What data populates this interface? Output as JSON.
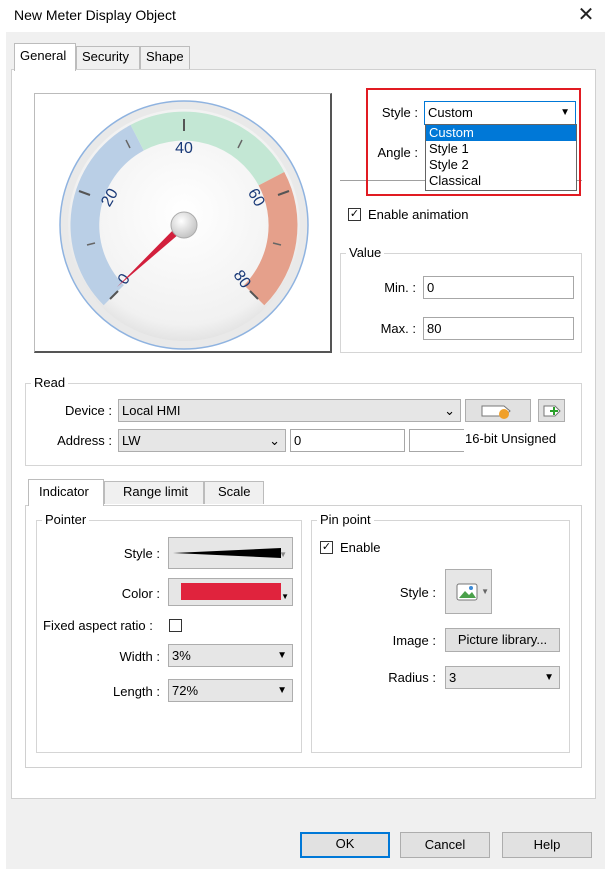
{
  "window": {
    "title": "New Meter Display Object",
    "close_icon": "close-icon"
  },
  "tabs": [
    "General",
    "Security",
    "Shape"
  ],
  "meter": {
    "ticks": [
      "0",
      "20",
      "40",
      "60",
      "80"
    ],
    "low_color": "#b9cde3",
    "mid_color": "#bfe5d2",
    "high_color": "#e49c88",
    "needle_color": "#d21f3c"
  },
  "style": {
    "label": "Style :",
    "selected": "Custom",
    "options": [
      "Custom",
      "Style 1",
      "Style 2",
      "Classical"
    ]
  },
  "angle": {
    "label": "Angle :"
  },
  "enable_animation": {
    "label": "Enable animation",
    "checked": true
  },
  "value_group": {
    "title": "Value",
    "min_label": "Min. :",
    "min_value": "0",
    "max_label": "Max. :",
    "max_value": "80"
  },
  "read_group": {
    "title": "Read",
    "device_label": "Device :",
    "device_value": "Local HMI",
    "address_label": "Address :",
    "address_type": "LW",
    "address_value": "0",
    "data_format": "16-bit Unsigned"
  },
  "sub_tabs": [
    "Indicator",
    "Range limit",
    "Scale"
  ],
  "pointer_group": {
    "title": "Pointer",
    "style_label": "Style :",
    "color_label": "Color :",
    "color_value": "#e0233d",
    "fixed_aspect_label": "Fixed aspect ratio :",
    "fixed_aspect_checked": false,
    "width_label": "Width :",
    "width_value": "3%",
    "length_label": "Length :",
    "length_value": "72%"
  },
  "pin_point_group": {
    "title": "Pin point",
    "enable_label": "Enable",
    "enable_checked": true,
    "style_label": "Style :",
    "image_label": "Image :",
    "image_button": "Picture library...",
    "radius_label": "Radius :",
    "radius_value": "3"
  },
  "buttons": {
    "ok": "OK",
    "cancel": "Cancel",
    "help": "Help"
  }
}
